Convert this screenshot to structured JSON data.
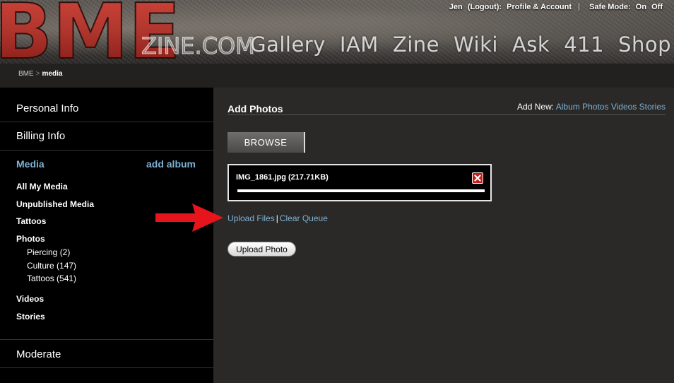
{
  "header": {
    "logo_main": "BME",
    "logo_sub": "ZINE.COM",
    "user_name": "Jen",
    "logout_label": "(Logout):",
    "profile_label": "Profile & Account",
    "separator": "|",
    "safe_mode_label": "Safe Mode:",
    "safe_mode_on": "On",
    "safe_mode_off": "Off",
    "nav": [
      "Gallery",
      "IAM",
      "Zine",
      "Wiki",
      "Ask",
      "411",
      "Shop"
    ]
  },
  "breadcrumb": {
    "home": "BME",
    "separator": ">",
    "current": "media"
  },
  "sidebar": {
    "personal_info": "Personal Info",
    "billing_info": "Billing Info",
    "media_title": "Media",
    "add_album": "add album",
    "links": [
      "All My Media",
      "Unpublished Media",
      "Tattoos",
      "Photos"
    ],
    "photo_albums": [
      "Piercing (2)",
      "Culture (147)",
      "Tattoos (541)"
    ],
    "videos": "Videos",
    "stories": "Stories",
    "moderate": "Moderate"
  },
  "main": {
    "title": "Add Photos",
    "add_new_label": "Add New:",
    "add_new_links": [
      "Album",
      "Photos",
      "Videos",
      "Stories"
    ],
    "browse_label": "BROWSE",
    "queue": {
      "file_name": "IMG_1861.jpg (217.71KB)",
      "progress": 1.0
    },
    "upload_files_label": "Upload Files",
    "pipe": "|",
    "clear_queue_label": "Clear Queue",
    "upload_photo_label": "Upload Photo"
  },
  "colors": {
    "link_blue": "#7cb2d6",
    "arrow_red": "#e8141b",
    "close_red": "#c0201c"
  },
  "icons": {
    "close": "close-icon",
    "arrow": "red-arrow-icon"
  }
}
